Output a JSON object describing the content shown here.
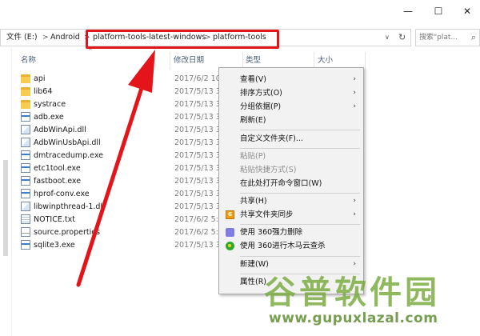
{
  "window": {
    "minimize_glyph": "—",
    "maximize_glyph": "☐",
    "close_glyph": "✕"
  },
  "address": {
    "crumbs": [
      "文件 (E:)",
      "Android",
      "platform-tools-latest-windows",
      "platform-tools"
    ],
    "separator": ">",
    "dropdown_glyph": "∨",
    "refresh_glyph": "↻"
  },
  "search": {
    "placeholder": "搜索\"plat...",
    "icon": "search-icon",
    "icon_glyph": "⌕"
  },
  "columns": {
    "name": "名称",
    "date": "修改日期",
    "type": "类型",
    "size": "大小",
    "sort_glyph": "^"
  },
  "files": [
    {
      "name": "api",
      "date": "2017/6/2 10:",
      "kind": "folder"
    },
    {
      "name": "lib64",
      "date": "2017/5/13 3:",
      "kind": "folder"
    },
    {
      "name": "systrace",
      "date": "2017/5/13 3:",
      "kind": "folder"
    },
    {
      "name": "adb.exe",
      "date": "2017/5/13 3:",
      "kind": "exe"
    },
    {
      "name": "AdbWinApi.dll",
      "date": "2017/5/13 3:",
      "kind": "dll"
    },
    {
      "name": "AdbWinUsbApi.dll",
      "date": "2017/5/13 3:",
      "kind": "dll"
    },
    {
      "name": "dmtracedump.exe",
      "date": "2017/5/13 3:",
      "kind": "exe"
    },
    {
      "name": "etc1tool.exe",
      "date": "2017/5/13 3:",
      "kind": "exe"
    },
    {
      "name": "fastboot.exe",
      "date": "2017/5/13 3:",
      "kind": "exe"
    },
    {
      "name": "hprof-conv.exe",
      "date": "2017/5/13 3:",
      "kind": "exe"
    },
    {
      "name": "libwinpthread-1.dll",
      "date": "2017/5/13 3:",
      "kind": "dll"
    },
    {
      "name": "NOTICE.txt",
      "date": "2017/6/2 5:",
      "kind": "txt"
    },
    {
      "name": "source.properties",
      "date": "2017/6/2 5:3",
      "kind": "prop"
    },
    {
      "name": "sqlite3.exe",
      "date": "2017/5/13 3:",
      "kind": "exe"
    }
  ],
  "context_menu": {
    "view": "查看(V)",
    "sort_by": "排序方式(O)",
    "group_by": "分组依据(P)",
    "refresh": "刷新(E)",
    "customize_folder": "自定义文件夹(F)...",
    "paste": "粘贴(P)",
    "paste_shortcut": "粘贴快捷方式(S)",
    "open_cmd_here": "在此处打开命令窗口(W)",
    "share": "共享(H)",
    "share_folder_sync": "共享文件夹同步",
    "shred_360": "使用 360强力删除",
    "scan_360": "使用 360进行木马云查杀",
    "new": "新建(W)",
    "properties": "属性(R)",
    "submenu_glyph": "›",
    "sync_icon_glyph": "6"
  },
  "watermark": {
    "logo": "谷普软件园",
    "url": "www.gupuxlazal.com"
  },
  "colors": {
    "highlight_red": "#e4151a",
    "menu_bg": "#f2f2f2",
    "header_text": "#4c607a",
    "folder_yellow": "#f7cb4d",
    "watermark_green": "#78aa3c"
  }
}
